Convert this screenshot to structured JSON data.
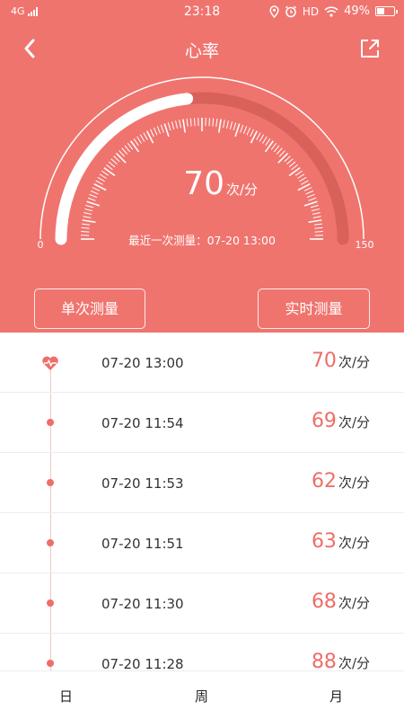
{
  "status_bar": {
    "network": "4G",
    "time": "23:18",
    "hd": "HD",
    "battery": "49%",
    "battery_level": 0.49
  },
  "header": {
    "title": "心率",
    "back_icon": "chevron-left-icon",
    "share_icon": "share-external-icon"
  },
  "gauge": {
    "min_label": "0",
    "max_label": "150",
    "min": 0,
    "max": 150,
    "value": 70,
    "value_text": "70",
    "unit": "次/分",
    "last_measure": "最近一次测量：07-20 13:00",
    "colors": {
      "track": "#d9615c",
      "fill": "#ffffff",
      "ticks": "#ffffff"
    }
  },
  "buttons": {
    "single": "单次测量",
    "realtime": "实时测量"
  },
  "records": [
    {
      "time": "07-20 13:00",
      "value": "70",
      "unit": "次/分",
      "latest": true
    },
    {
      "time": "07-20 11:54",
      "value": "69",
      "unit": "次/分",
      "latest": false
    },
    {
      "time": "07-20 11:53",
      "value": "62",
      "unit": "次/分",
      "latest": false
    },
    {
      "time": "07-20 11:51",
      "value": "63",
      "unit": "次/分",
      "latest": false
    },
    {
      "time": "07-20 11:30",
      "value": "68",
      "unit": "次/分",
      "latest": false
    },
    {
      "time": "07-20 11:28",
      "value": "88",
      "unit": "次/分",
      "latest": false
    }
  ],
  "tabs": {
    "day": "日",
    "week": "周",
    "month": "月"
  },
  "colors": {
    "accent": "#f0746e",
    "value_text": "#ee6e68"
  }
}
